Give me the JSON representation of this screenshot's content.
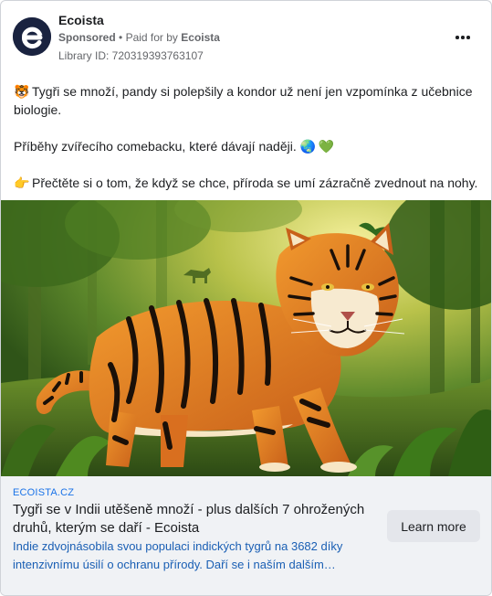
{
  "advertiser": {
    "name": "Ecoista",
    "sponsored_label": "Sponsored",
    "separator": "•",
    "paid_for_prefix": "Paid for by",
    "paid_for_name": "Ecoista",
    "library_id": "Library ID: 720319393763107",
    "logo_letter": "e"
  },
  "post": {
    "line1_emoji": "🐯",
    "line1_text": "Tygři se množí, pandy si polepšily a kondor už není jen vzpomínka z učebnice biologie.",
    "line2_text": "Příběhy zvířecího comebacku, které dávají naději.",
    "line2_emoji1": "🌏",
    "line2_emoji2": "💚",
    "line3_emoji": "👉",
    "line3_text": "Přečtěte si o tom, že když se chce, příroda se umí zázračně zvednout na nohy."
  },
  "link": {
    "domain": "ECOISTA.CZ",
    "headline": "Tygři se v Indii utěšeně množí - plus dalších 7 ohrožených druhů, kterým se daří - Ecoista",
    "description": "Indie zdvojnásobila svou populaci indických tygrů na 3682 díky intenzivnímu úsilí o ochranu přírody. Daří se i naším dalším…",
    "cta_label": "Learn more"
  },
  "icons": {
    "more": "more-options-icon",
    "image": "tiger-in-jungle-illustration"
  },
  "colors": {
    "link_blue": "#1a73e8",
    "cta_bg": "#e4e6eb",
    "link_area_bg": "#f0f2f5",
    "logo_bg": "#1a2340"
  }
}
